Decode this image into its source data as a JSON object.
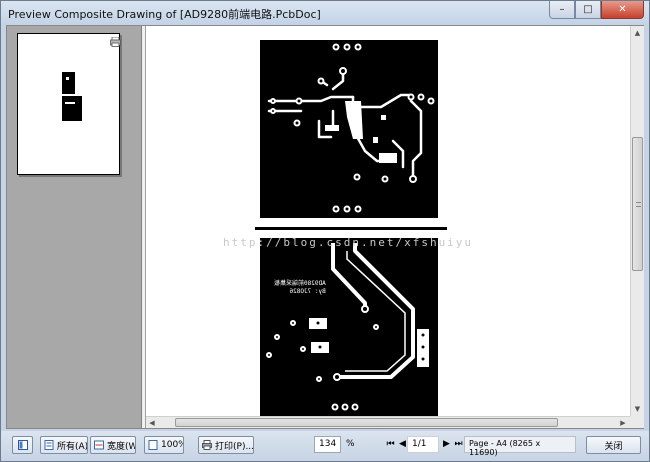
{
  "window": {
    "title": "Preview Composite Drawing of [AD9280前端电路.PcbDoc]",
    "minimize_label": "–",
    "maximize_label": "□",
    "close_label": "✕"
  },
  "preview": {
    "watermark": "http://blog.csdn.net/xfshuiyu",
    "silkscreen_line1": "AD9280前端采集板",
    "silkscreen_line2": "By: 7JO826"
  },
  "toolbar": {
    "all_label": "所有(A)",
    "width_label": "宽度(W)",
    "zoom_100_label": "100%",
    "print_label": "打印(P)...",
    "zoom_value": "134",
    "zoom_unit": "%",
    "page_value": "1/1",
    "page_info": "Page - A4 (8265 x 11690)",
    "close_label": "关闭"
  },
  "colors": {
    "accent": "#7c8ea5",
    "pcb_background": "#000000",
    "trace": "#ffffff"
  }
}
